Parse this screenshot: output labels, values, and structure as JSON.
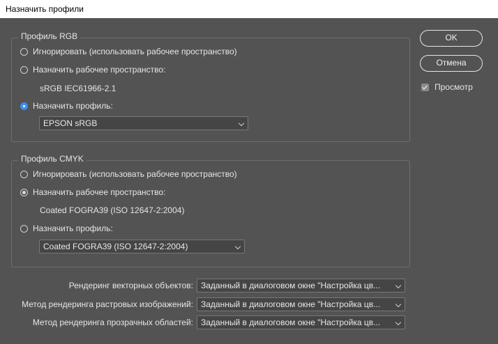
{
  "window": {
    "title": "Назначить профили"
  },
  "rgb": {
    "legend": "Профиль RGB",
    "option_ignore": "Игнорировать (использовать рабочее пространство)",
    "option_working": "Назначить рабочее пространство:",
    "working_value": "sRGB IEC61966-2.1",
    "option_assign": "Назначить профиль:",
    "assign_select": "EPSON  sRGB",
    "selected": "assign"
  },
  "cmyk": {
    "legend": "Профиль CMYK",
    "option_ignore": "Игнорировать (использовать рабочее пространство)",
    "option_working": "Назначить рабочее пространство:",
    "working_value": "Coated FOGRA39 (ISO 12647-2:2004)",
    "option_assign": "Назначить профиль:",
    "assign_select": "Coated FOGRA39 (ISO 12647-2:2004)",
    "selected": "working"
  },
  "buttons": {
    "ok": "OK",
    "cancel": "Отмена"
  },
  "preview": {
    "label": "Просмотр",
    "checked": true
  },
  "rendering": {
    "vector_label": "Рендеринг векторных объектов:",
    "vector_value": "Заданный в диалоговом окне \"Настройка цв...",
    "raster_label": "Метод рендеринга растровых изображений:",
    "raster_value": "Заданный в диалоговом окне \"Настройка цв...",
    "transparent_label": "Метод рендеринга прозрачных областей:",
    "transparent_value": "Заданный в диалоговом окне \"Настройка цв..."
  },
  "colors": {
    "accent": "#3b8ff0",
    "background": "#535353"
  }
}
